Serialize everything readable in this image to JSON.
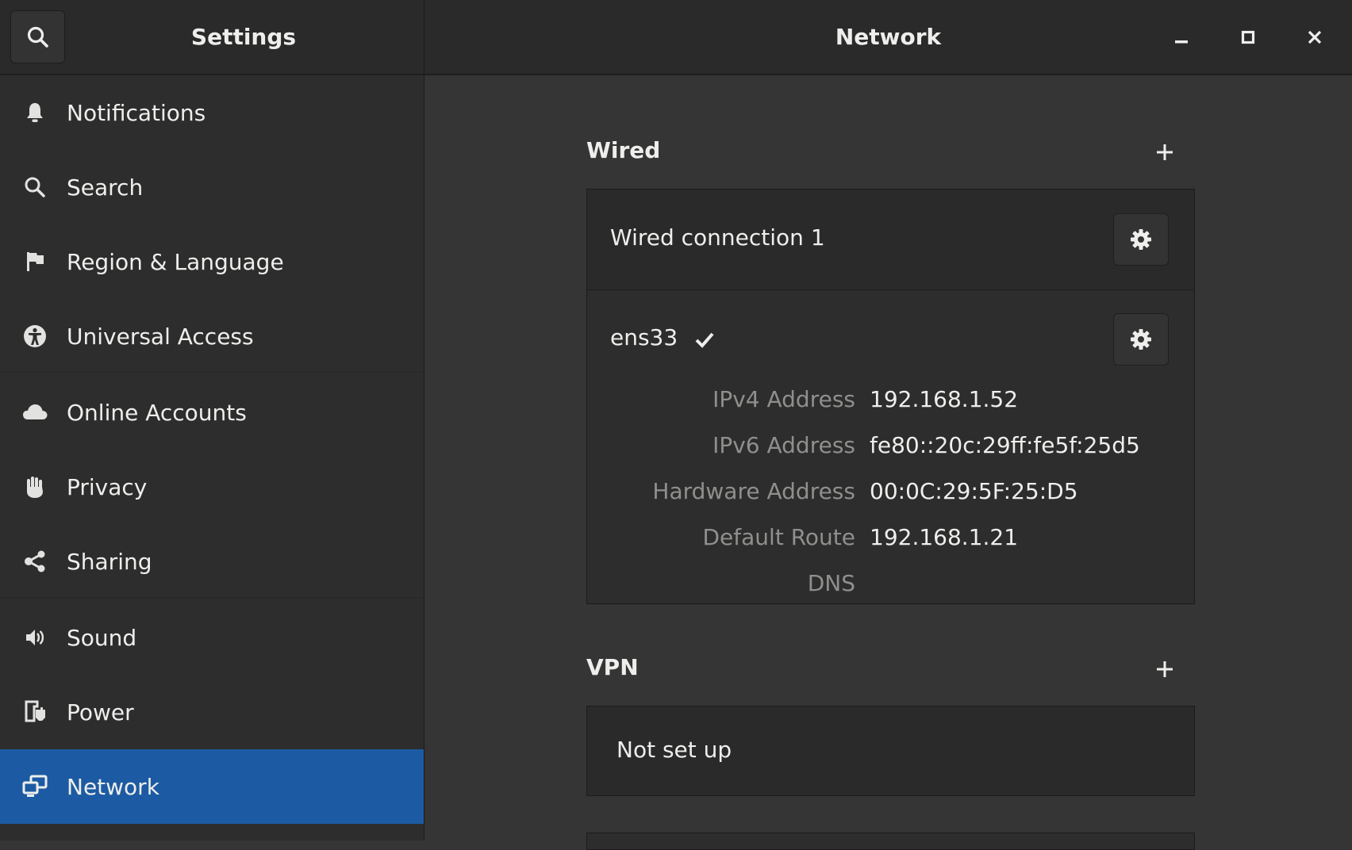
{
  "header": {
    "app_title": "Settings",
    "page_title": "Network",
    "search_icon": "search-icon",
    "window_controls": [
      "minimize-icon",
      "maximize-icon",
      "close-icon"
    ]
  },
  "sidebar": {
    "items": [
      {
        "label": "Notifications",
        "icon": "bell-icon"
      },
      {
        "label": "Search",
        "icon": "search-icon"
      },
      {
        "label": "Region & Language",
        "icon": "flag-icon"
      },
      {
        "label": "Universal Access",
        "icon": "accessibility-icon"
      },
      {
        "label": "Online Accounts",
        "icon": "cloud-icon"
      },
      {
        "label": "Privacy",
        "icon": "hand-icon"
      },
      {
        "label": "Sharing",
        "icon": "share-icon"
      },
      {
        "label": "Sound",
        "icon": "speaker-icon"
      },
      {
        "label": "Power",
        "icon": "power-icon"
      },
      {
        "label": "Network",
        "icon": "network-icon",
        "active": true
      }
    ],
    "active_color": "#1c5ba3"
  },
  "wired": {
    "title": "Wired",
    "connection_name": "Wired connection 1",
    "device": {
      "name": "ens33",
      "connected": true,
      "details": [
        {
          "label": "IPv4 Address",
          "value": "192.168.1.52"
        },
        {
          "label": "IPv6 Address",
          "value": "fe80::20c:29ff:fe5f:25d5"
        },
        {
          "label": "Hardware Address",
          "value": "00:0C:29:5F:25:D5"
        },
        {
          "label": "Default Route",
          "value": "192.168.1.21"
        },
        {
          "label": "DNS",
          "value": ""
        }
      ]
    }
  },
  "vpn": {
    "title": "VPN",
    "status": "Not set up"
  }
}
